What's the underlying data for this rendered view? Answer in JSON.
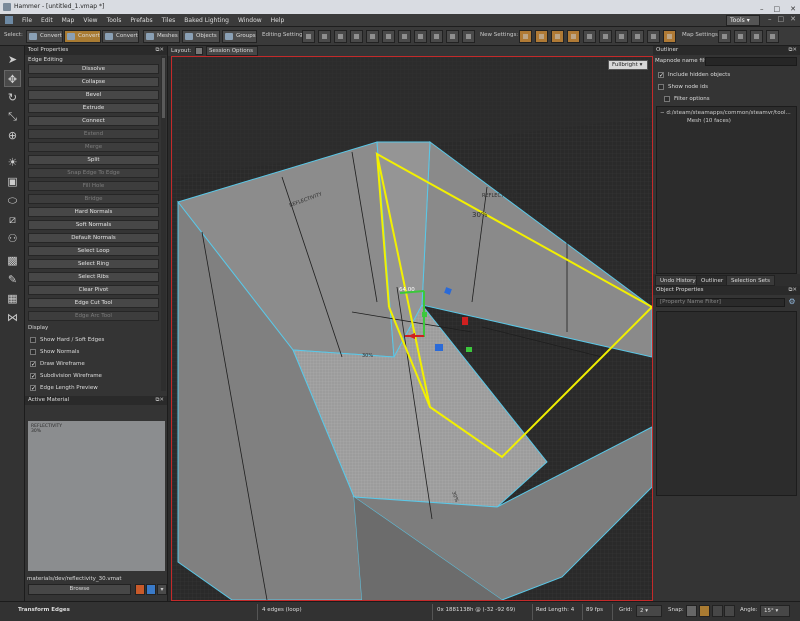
{
  "window": {
    "title": "Hammer - [untitled_1.vmap *]",
    "controls": [
      "–",
      "□",
      "✕"
    ]
  },
  "menubar": {
    "items": [
      "File",
      "Edit",
      "Map",
      "View",
      "Tools",
      "Prefabs",
      "Tiles",
      "Baked Lighting",
      "Window",
      "Help"
    ],
    "tools_button": "Tools ▾"
  },
  "toolbar": {
    "select_label": "Select:",
    "convert1": "Convert",
    "convert2": "Convert",
    "convert3": "Convert",
    "meshes": "Meshes",
    "objects": "Objects",
    "groups": "Groups",
    "editing_settings": "Editing Settings:",
    "new_settings": "New Settings:",
    "map_settings": "Map Settings:"
  },
  "tool_properties": {
    "title": "Tool Properties",
    "section": "Edge Editing",
    "buttons": [
      {
        "label": "Dissolve",
        "enabled": true
      },
      {
        "label": "Collapse",
        "enabled": true
      },
      {
        "label": "Bevel",
        "enabled": true
      },
      {
        "label": "Extrude",
        "enabled": true
      },
      {
        "label": "Connect",
        "enabled": true
      },
      {
        "label": "Extend",
        "enabled": false
      },
      {
        "label": "Merge",
        "enabled": false
      },
      {
        "label": "Split",
        "enabled": true
      },
      {
        "label": "Snap Edge To Edge",
        "enabled": false
      },
      {
        "label": "Fill Hole",
        "enabled": false
      },
      {
        "label": "Bridge",
        "enabled": false
      },
      {
        "label": "Hard Normals",
        "enabled": true
      },
      {
        "label": "Soft Normals",
        "enabled": true
      },
      {
        "label": "Default Normals",
        "enabled": true
      },
      {
        "label": "Select Loop",
        "enabled": true
      },
      {
        "label": "Select Ring",
        "enabled": true
      },
      {
        "label": "Select Ribs",
        "enabled": true
      },
      {
        "label": "Clear Pivot",
        "enabled": true
      },
      {
        "label": "Edge Cut Tool",
        "enabled": true
      },
      {
        "label": "Edge Arc Tool",
        "enabled": false
      }
    ],
    "display_section": "Display",
    "display_options": [
      {
        "label": "Show Hard / Soft Edges",
        "checked": false
      },
      {
        "label": "Show Normals",
        "checked": false
      },
      {
        "label": "Draw Wireframe",
        "checked": true
      },
      {
        "label": "Subdivision Wireframe",
        "checked": true
      },
      {
        "label": "Edge Length Preview",
        "checked": true
      }
    ]
  },
  "active_material": {
    "title": "Active Material",
    "preview_text": "REFLECTIVITY\n30%",
    "path": "materials/dev/reflectivity_30.vmat",
    "browse": "Browse"
  },
  "viewport": {
    "layout_label": "Layout:",
    "session_options": "Session Options ▾",
    "render_mode": "Fullbright ▾",
    "measure_label": "64.00",
    "colors": {
      "selection": "#f2f000",
      "wire": "#5ac8e8",
      "border": "#c42a2a"
    }
  },
  "outliner": {
    "title": "Outliner",
    "mapnode_filter_label": "Mapnode name filter",
    "include_hidden": {
      "label": "Include hidden objects",
      "checked": true
    },
    "show_node_ids": {
      "label": "Show node ids",
      "checked": false
    },
    "filter_options": {
      "label": "Filter options",
      "checked": false
    },
    "tree": [
      "d:/steam/steamapps/common/steamvr/tool...",
      "Mesh (10 faces)"
    ]
  },
  "outliner_tabs": [
    "Undo History",
    "Outliner",
    "Selection Sets"
  ],
  "object_properties": {
    "title": "Object Properties",
    "filter_placeholder": "[Property Name Filter]"
  },
  "statusbar": {
    "tool": "Transform Edges",
    "selection": "4 edges (loop)",
    "coords": "0x 1881138h @ (-32 -92 69)",
    "red_length": "Red Length: 4",
    "fps": "89 fps",
    "grid_label": "Grid:",
    "grid_value": "2",
    "snap_label": "Snap:",
    "angle_label": "Angle:",
    "angle_value": "15°"
  }
}
